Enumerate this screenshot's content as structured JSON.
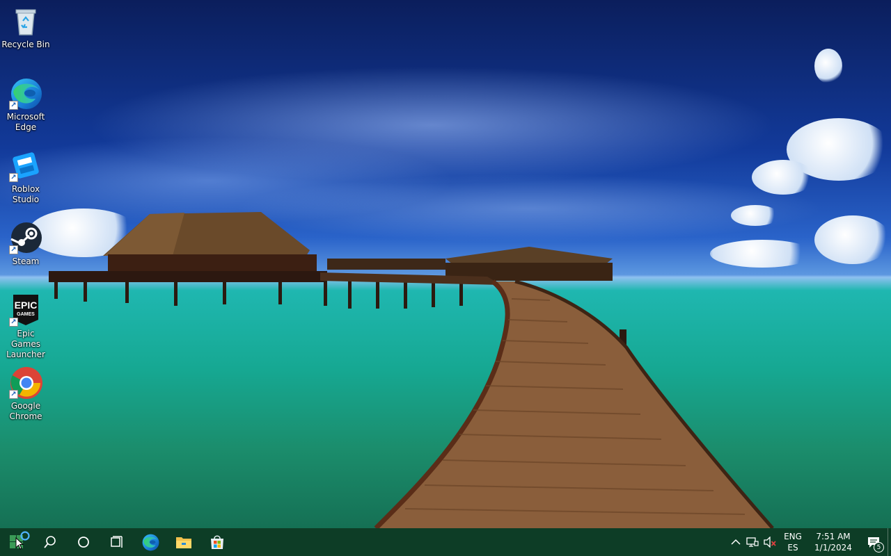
{
  "desktop": {
    "icons": [
      {
        "label": "Recycle Bin",
        "icon": "recycle-bin-icon"
      },
      {
        "label": "Microsoft Edge",
        "icon": "edge-icon"
      },
      {
        "label": "Roblox Studio",
        "icon": "roblox-studio-icon"
      },
      {
        "label": "Steam",
        "icon": "steam-icon"
      },
      {
        "label": "Epic Games Launcher",
        "icon": "epic-games-icon"
      },
      {
        "label": "Google Chrome",
        "icon": "chrome-icon"
      }
    ],
    "epic_logo_text": "EPIC",
    "epic_logo_sub": "GAMES"
  },
  "taskbar": {
    "pinned": [
      {
        "name": "start-button",
        "icon": "windows-logo-icon"
      },
      {
        "name": "search-button",
        "icon": "search-icon"
      },
      {
        "name": "cortana-button",
        "icon": "cortana-circle-icon"
      },
      {
        "name": "task-view-button",
        "icon": "task-view-icon"
      },
      {
        "name": "edge-taskbar-button",
        "icon": "edge-icon"
      },
      {
        "name": "file-explorer-button",
        "icon": "folder-icon"
      },
      {
        "name": "microsoft-store-button",
        "icon": "store-icon"
      }
    ],
    "tray": {
      "language_line1": "ENG",
      "language_line2": "ES",
      "time": "7:51 AM",
      "date": "1/1/2024",
      "notification_count": "5"
    }
  },
  "colors": {
    "taskbar": "#0d3d26",
    "accent": "#8fd1ff"
  }
}
